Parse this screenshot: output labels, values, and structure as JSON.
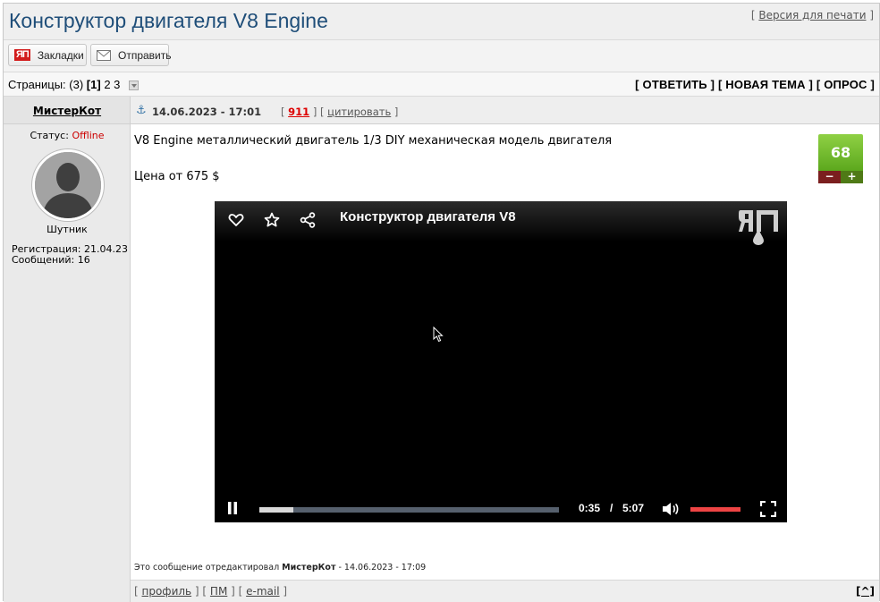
{
  "header": {
    "title": "Конструктор двигателя V8 Engine",
    "print_prefix": "[ ",
    "print_link": "Версия для печати",
    "print_suffix": " ]"
  },
  "toolbar": {
    "bookmarks_icon": "ЯП",
    "bookmarks_label": "Закладки",
    "send_label": "Отправить"
  },
  "pagination": {
    "label": "Страницы:",
    "count": "(3)",
    "current": "[1]",
    "page2": "2",
    "page3": "3"
  },
  "actions": {
    "text": "[ ОТВЕТИТЬ ] [ НОВАЯ ТЕМА ] [ ОПРОС ]"
  },
  "user": {
    "name": "МистерКот",
    "status_label": "Статус:",
    "status_value": "Offline",
    "rank": "Шутник",
    "registration": "Регистрация: 21.04.23",
    "messages": "Сообщений: 16"
  },
  "post": {
    "date": "14.06.2023 - 17:01",
    "open_bracket": "[ ",
    "number": "911",
    "mid_bracket": " ] [ ",
    "quote_label": "цитировать",
    "close_bracket": " ]",
    "line1": "V8 Engine металлический двигатель 1/3 DIY механическая модель двигателя",
    "line2": "Цена от 675 $",
    "rating": "68",
    "minus": "−",
    "plus": "+",
    "edit_prefix": "Это сообщение отредактировал ",
    "edit_author": "МистерКот",
    "edit_suffix": " - 14.06.2023 - 17:09"
  },
  "video": {
    "title": "Конструктор двигателя V8",
    "current_time": "0:35",
    "separator": "/",
    "duration": "5:07",
    "progress_fraction": 0.114
  },
  "footer": {
    "profile": "профиль",
    "pm": "ПМ",
    "email": "e-mail",
    "top": "[^]"
  }
}
